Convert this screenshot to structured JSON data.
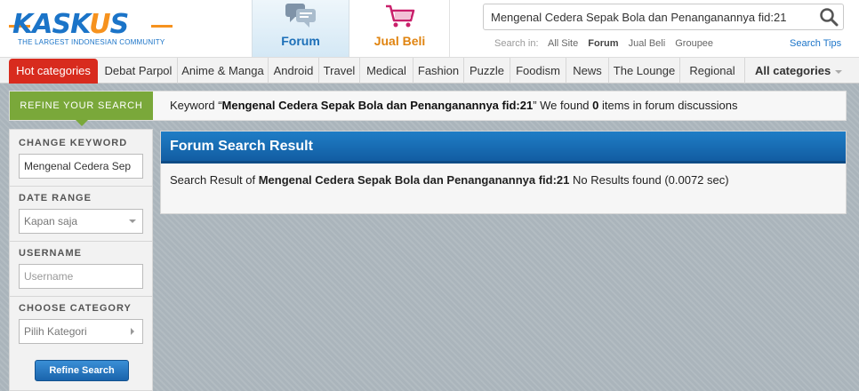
{
  "header": {
    "logo": {
      "text": "KASKUS",
      "tagline": "THE LARGEST INDONESIAN COMMUNITY"
    },
    "tabs": [
      {
        "label": "Forum",
        "active": true,
        "icon": "forum-icon"
      },
      {
        "label": "Jual Beli",
        "active": false,
        "icon": "shopping-cart-icon"
      }
    ],
    "search": {
      "value": "Mengenal Cedera Sepak Bola dan Penanganannya fid:21",
      "search_in_label": "Search in:",
      "options": [
        "All Site",
        "Forum",
        "Jual Beli",
        "Groupee"
      ],
      "active_option": "Forum",
      "tips_label": "Search Tips"
    }
  },
  "categories": {
    "hot_label": "Hot categories",
    "items": [
      "Debat Parpol",
      "Anime & Manga",
      "Android",
      "Travel",
      "Medical",
      "Fashion",
      "Puzzle",
      "Foodism",
      "News",
      "The Lounge",
      "Regional"
    ],
    "all_label": "All categories"
  },
  "refine_bar": {
    "label": "REFINE YOUR SEARCH",
    "prefix": "Keyword “",
    "keyword": "Mengenal Cedera Sepak Bola dan Penanganannya fid:21",
    "middle": "” We found ",
    "count": "0",
    "suffix": " items in forum discussions"
  },
  "sidebar": {
    "keyword_title": "CHANGE KEYWORD",
    "keyword_value": "Mengenal Cedera Sep",
    "date_title": "DATE RANGE",
    "date_value": "Kapan saja",
    "username_title": "USERNAME",
    "username_placeholder": "Username",
    "category_title": "CHOOSE CATEGORY",
    "category_value": "Pilih Kategori",
    "button_label": "Refine Search"
  },
  "result": {
    "title": "Forum Search Result",
    "prefix": "Search Result of ",
    "keyword": "Mengenal Cedera Sepak Bola dan Penanganannya fid:21",
    "suffix": " No Results found (0.0072 sec)"
  },
  "colors": {
    "brand_blue": "#1b74c8",
    "brand_orange": "#f6921e",
    "hot_red": "#d82b1e",
    "refine_green": "#7aa83a",
    "panel_blue": "#1f7dc6"
  }
}
